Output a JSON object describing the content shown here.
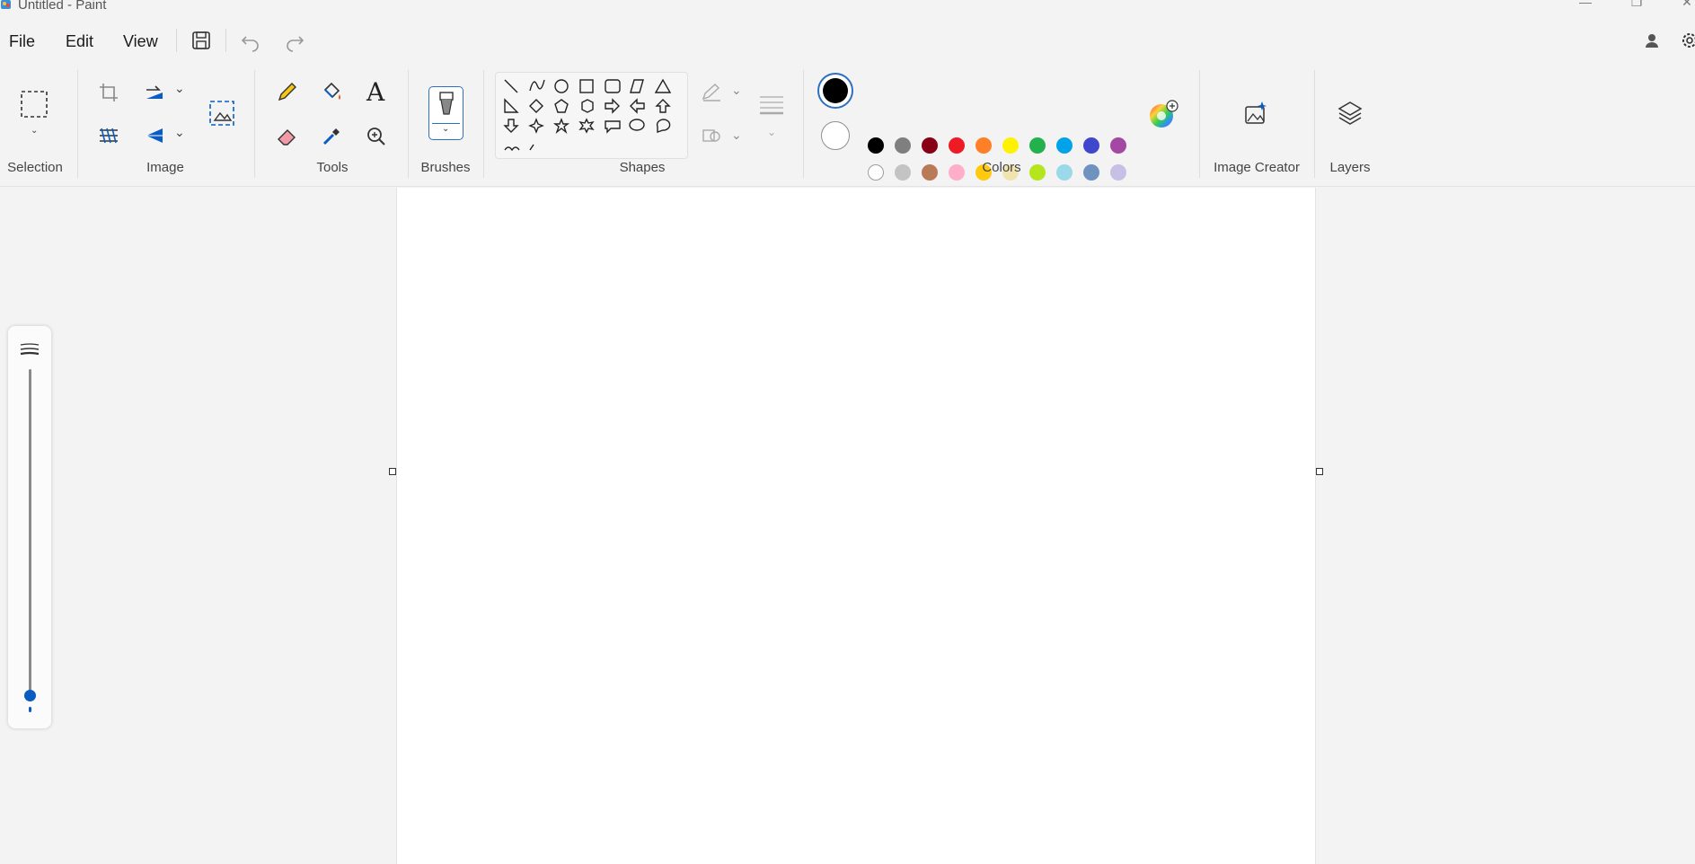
{
  "window": {
    "title": "Untitled - Paint"
  },
  "menu": {
    "file": "File",
    "edit": "Edit",
    "view": "View"
  },
  "ribbon": {
    "groups": {
      "selection": "Selection",
      "image": "Image",
      "tools": "Tools",
      "brushes": "Brushes",
      "shapes": "Shapes",
      "colors": "Colors",
      "image_creator": "Image Creator",
      "layers": "Layers"
    },
    "text_tool_glyph": "A"
  },
  "colors": {
    "primary": "#000000",
    "secondary": "#ffffff",
    "accent": "#0a5cc2",
    "row1": [
      "#000000",
      "#7f7f7f",
      "#880015",
      "#ed1c24",
      "#ff7f27",
      "#fff200",
      "#22b14c",
      "#00a2e8",
      "#3f48cc",
      "#a349a4"
    ],
    "row2": [
      "#ffffff",
      "#c3c3c3",
      "#b97a57",
      "#ffaec9",
      "#ffc90e",
      "#efe4b0",
      "#b5e61d",
      "#99d9ea",
      "#7092be",
      "#c8bfe7"
    ],
    "row3": [
      "",
      "",
      "",
      "",
      "",
      "",
      "",
      "",
      "",
      ""
    ]
  },
  "icons": {
    "app": "paint-app-icon",
    "save": "save-icon",
    "undo": "undo-icon",
    "redo": "redo-icon",
    "account": "account-icon",
    "settings": "gear-icon"
  }
}
